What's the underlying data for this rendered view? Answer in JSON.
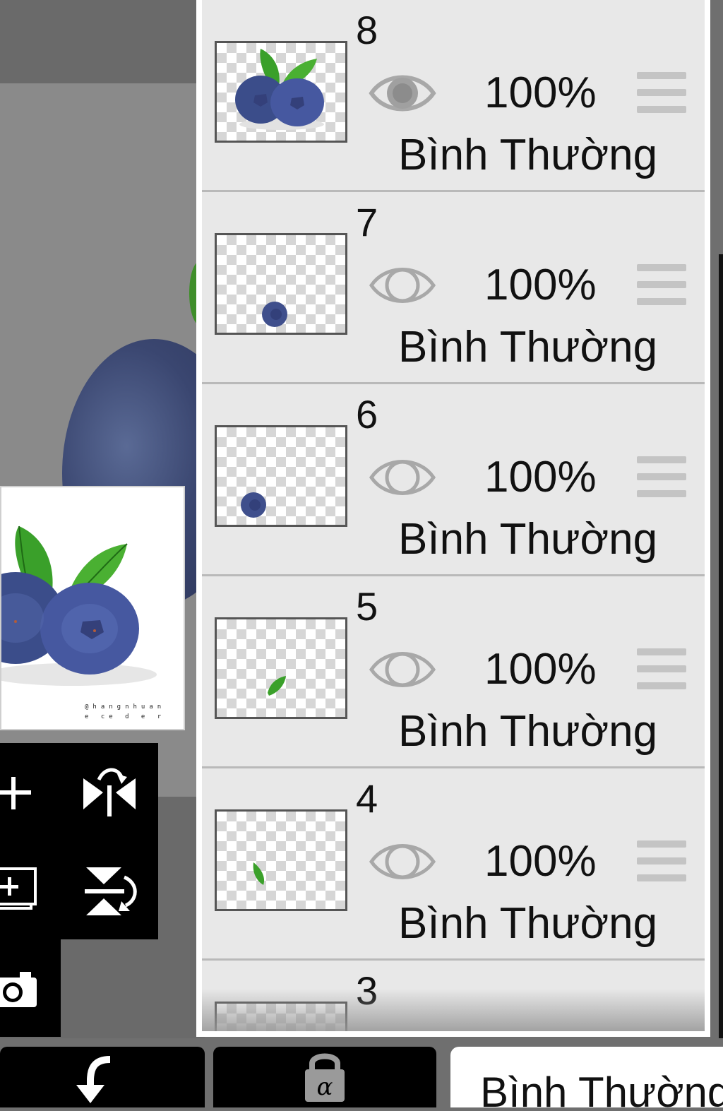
{
  "layers": [
    {
      "number": "8",
      "opacity": "100%",
      "blend": "Bình Thường",
      "visible": true
    },
    {
      "number": "7",
      "opacity": "100%",
      "blend": "Bình Thường",
      "visible": false
    },
    {
      "number": "6",
      "opacity": "100%",
      "blend": "Bình Thường",
      "visible": false
    },
    {
      "number": "5",
      "opacity": "100%",
      "blend": "Bình Thường",
      "visible": false
    },
    {
      "number": "4",
      "opacity": "100%",
      "blend": "Bình Thường",
      "visible": false
    },
    {
      "number": "3"
    }
  ],
  "preview": {
    "signature_line1": "@hangnhuan",
    "signature_line2": "e ce d e r"
  },
  "tools": {
    "add_layer": "plus-icon",
    "flip_horizontal": "flip-horizontal-icon",
    "add_layer_copy": "add-layer-copy-icon",
    "flip_vertical": "flip-vertical-icon",
    "camera": "camera-icon"
  },
  "bottom_bar": {
    "back_icon": "return-arrow-icon",
    "alpha_lock_icon": "alpha-lock-icon",
    "blend_mode": "Bình Thường"
  },
  "colors": {
    "panel_bg": "#e8e8e8",
    "berry": "#3a4670",
    "leaf": "#3f9a2a"
  }
}
